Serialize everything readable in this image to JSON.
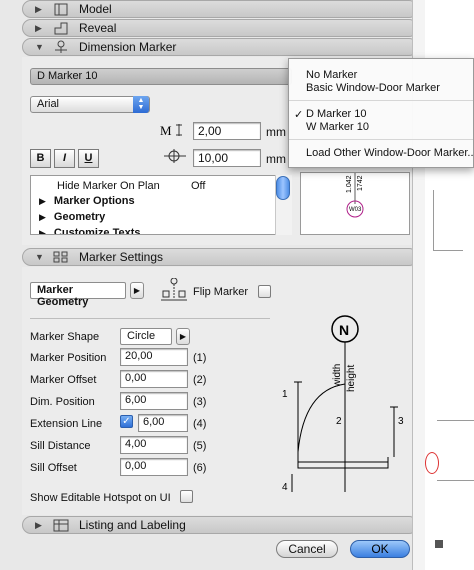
{
  "sections": {
    "model": "Model",
    "reveal": "Reveal",
    "dimension_marker": "Dimension Marker",
    "marker_settings": "Marker Settings",
    "listing_labeling": "Listing and Labeling"
  },
  "dimension_marker": {
    "marker_popup": "D Marker 10",
    "font_popup": "Arial",
    "size_value": "2,00",
    "offset_value": "10,00",
    "unit": "mm",
    "bold_label": "B",
    "italic_label": "I",
    "underline_label": "U",
    "list": [
      {
        "label": "Hide Marker On Plan",
        "value": "Off"
      },
      {
        "label": "Marker Options",
        "value": ""
      },
      {
        "label": "Geometry",
        "value": ""
      },
      {
        "label": "Customize Texts",
        "value": ""
      }
    ],
    "preview": {
      "tag": "W03",
      "dim1": "1.042",
      "dim2": "1742"
    }
  },
  "marker_settings": {
    "tab_popup": "Marker Geometry",
    "flip_label": "Flip Marker",
    "fields": [
      {
        "label": "Marker Shape",
        "value": "Circle",
        "index": ""
      },
      {
        "label": "Marker Position",
        "value": "20,00",
        "index": "(1)"
      },
      {
        "label": "Marker Offset",
        "value": "0,00",
        "index": "(2)"
      },
      {
        "label": "Dim. Position",
        "value": "6,00",
        "index": "(3)"
      },
      {
        "label": "Extension Line",
        "value": "6,00",
        "index": "(4)"
      },
      {
        "label": "Sill Distance",
        "value": "4,00",
        "index": "(5)"
      },
      {
        "label": "Sill Offset",
        "value": "0,00",
        "index": "(6)"
      }
    ],
    "hotspot_label": "Show Editable Hotspot on UI",
    "diagram": {
      "n": "N",
      "width": "width",
      "height": "height",
      "d1": "1",
      "d2": "2",
      "d3": "3",
      "d4": "4"
    }
  },
  "dropdown_menu": {
    "items": [
      "No Marker",
      "Basic Window-Door Marker",
      "D Marker 10",
      "W Marker 10",
      "Load Other Window-Door Marker..."
    ],
    "checked": "✓"
  },
  "buttons": {
    "cancel": "Cancel",
    "ok": "OK"
  }
}
